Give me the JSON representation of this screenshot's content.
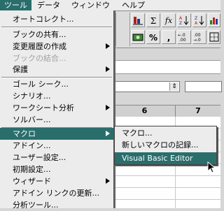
{
  "menubar": {
    "items": [
      {
        "label": "ツール",
        "active": true
      },
      {
        "label": "データ",
        "active": false
      },
      {
        "label": "ウィンドウ",
        "active": false
      },
      {
        "label": "ヘルプ",
        "active": false
      }
    ]
  },
  "toolbar": {
    "row1": [
      "Σ",
      "fx"
    ],
    "row2": [
      "%",
      ","
    ]
  },
  "sheet": {
    "column_headers": [
      "6",
      "7"
    ]
  },
  "menu": {
    "items": {
      "autocorrect": "オートコレクト...",
      "share_book": "ブックの共有...",
      "track_changes": "変更履歴の作成",
      "merge_books": "ブックの結合...",
      "protection": "保護",
      "goal_seek": "ゴール シーク...",
      "scenarios": "シナリオ...",
      "auditing": "ワークシート分析",
      "solver": "ソルバー...",
      "macro": "マクロ",
      "addins": "アドイン...",
      "customize": "ユーザー設定...",
      "options": "初期設定...",
      "wizard": "ウィザード",
      "update_addin_links": "アドイン リンクの更新...",
      "analysis_tools": "分析ツール..."
    }
  },
  "submenu": {
    "items": {
      "macros": "マクロ...",
      "record_new_macro": "新しいマクロの記録...",
      "vbe": "Visual Basic Editor"
    }
  },
  "colors": {
    "highlight": "#2a6e6c",
    "menu_bg": "#ececec",
    "disabled_text": "#a0a0a0"
  }
}
